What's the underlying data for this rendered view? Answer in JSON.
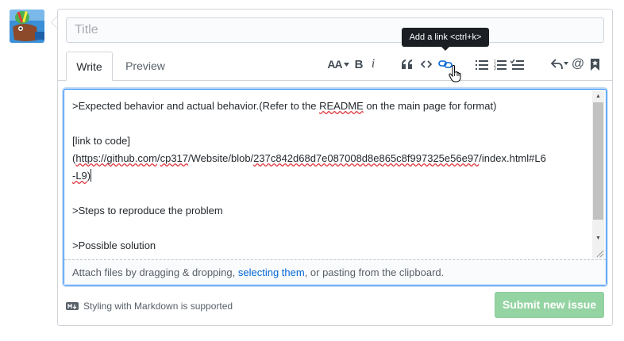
{
  "form": {
    "title_placeholder": "Title"
  },
  "tabs": [
    {
      "label": "Write",
      "active": true
    },
    {
      "label": "Preview",
      "active": false
    }
  ],
  "toolbar": {
    "heading_label": "AA",
    "bold_label": "B",
    "italic_label": "i",
    "tooltip": "Add a link <ctrl+k>",
    "icons": [
      "text-size-icon",
      "bold-icon",
      "italic-icon",
      "quote-icon",
      "code-icon",
      "link-icon",
      "unordered-list-icon",
      "ordered-list-icon",
      "task-list-icon",
      "reply-icon",
      "mention-icon",
      "bookmark-icon"
    ]
  },
  "editor": {
    "lines": [
      {
        "pre": ">Expected behavior and actual behavior.(Refer to the ",
        "sq": "README",
        "post": " on the main page for format)"
      },
      {
        "text": ""
      },
      {
        "text": "[link to code]"
      },
      {
        "pre": "(",
        "sq1": "https://github.com",
        "mid1": "/",
        "sq2": "cp317",
        "mid2": "/Website/blob/",
        "sq3": "237c842d68d7e087008d8e865c8f997325e56e97",
        "post": "/index.html#L6"
      },
      {
        "sq": "-L9",
        "post": ")"
      },
      {
        "text": ""
      },
      {
        "text": ">Steps to reproduce the problem"
      },
      {
        "text": ""
      },
      {
        "text": ">Possible solution"
      }
    ]
  },
  "dropzone": {
    "pre": "Attach files by dragging & dropping, ",
    "link": "selecting them",
    "post": ", or pasting from the clipboard."
  },
  "markdown_note": "Styling with Markdown is supported",
  "submit_label": "Submit new issue",
  "colors": {
    "accent_blue": "#0366d6",
    "submit_disabled": "#94d3a2",
    "focus_border": "#2188ff"
  }
}
